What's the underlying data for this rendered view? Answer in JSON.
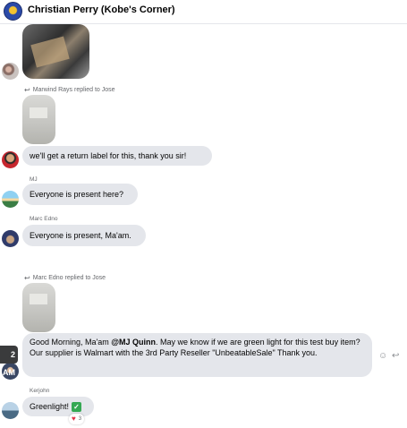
{
  "header": {
    "title": "Christian Perry (Kobe's Corner)"
  },
  "messages": {
    "reply_note_1": "Marwind Rays replied to Jose",
    "msg1": "we'll get a return label for this, thank you sir!",
    "sender_mj": "MJ",
    "msg2": "Everyone is present here?",
    "sender_marc": "Marc Edno",
    "msg3": "Everyone is present, Ma'am.",
    "reply_note_2": "Marc Edno replied to Jose",
    "msg4_prefix": "Good Morning, Ma'am ",
    "msg4_mention": "@MJ Quinn",
    "msg4_suffix": ". May we know if we are green light for this test buy item? Our supplier is Walmart with the 3rd Party Reseller \"UnbeatableSale\" Thank you.",
    "sender_kerjohn": "Kerjohn",
    "msg5": "Greenlight!",
    "msg5_emoji": "✓",
    "reaction_count": "3",
    "reaction_emoji": "♥"
  },
  "time_badge": "2 AM",
  "icons": {
    "reply": "reply-arrow-icon",
    "emoji": "emoji-icon",
    "reply_action": "reply-icon"
  }
}
